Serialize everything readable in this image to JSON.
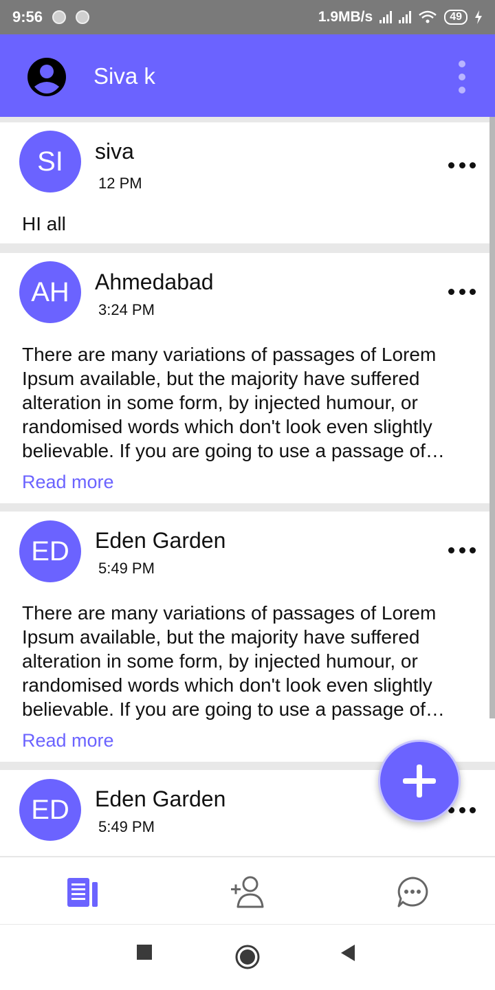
{
  "status_bar": {
    "time": "9:56",
    "network_speed": "1.9MB/s",
    "battery": "49"
  },
  "app_bar": {
    "title": "Siva k"
  },
  "posts": [
    {
      "initials": "SI",
      "name": "siva",
      "time": "12 PM",
      "body": "HI all",
      "read_more": ""
    },
    {
      "initials": "AH",
      "name": "Ahmedabad",
      "time": "3:24 PM",
      "body": "There are many variations of passages of Lorem Ipsum available, but the majority have suffered alteration in some form, by injected humour, or randomised words which don't look even slightly believable. If you are going to use a passage of Lorem Ipsum.",
      "read_more": "Read more"
    },
    {
      "initials": "ED",
      "name": "Eden Garden",
      "time": "5:49 PM",
      "body": "There are many variations of passages of Lorem Ipsum available, but the majority have suffered alteration in some form, by injected humour, or randomised words which don't look even slightly believable. If you are going to use a passage of Lorem Ipsum.",
      "read_more": "Read more"
    },
    {
      "initials": "ED",
      "name": "Eden Garden",
      "time": "5:49 PM",
      "body": "",
      "read_more": ""
    }
  ],
  "colors": {
    "accent": "#6b63ff",
    "status_bar_bg": "#7a7a7a"
  },
  "icons": {
    "profile": "account-circle-icon",
    "overflow": "more-vertical-icon",
    "post_menu": "more-horizontal-icon",
    "fab": "add-icon",
    "nav_feed": "feed-document-icon",
    "nav_add_friend": "add-person-icon",
    "nav_chat": "chat-bubble-icon",
    "sys_recents": "square-icon",
    "sys_home": "circle-icon",
    "sys_back": "triangle-back-icon"
  }
}
